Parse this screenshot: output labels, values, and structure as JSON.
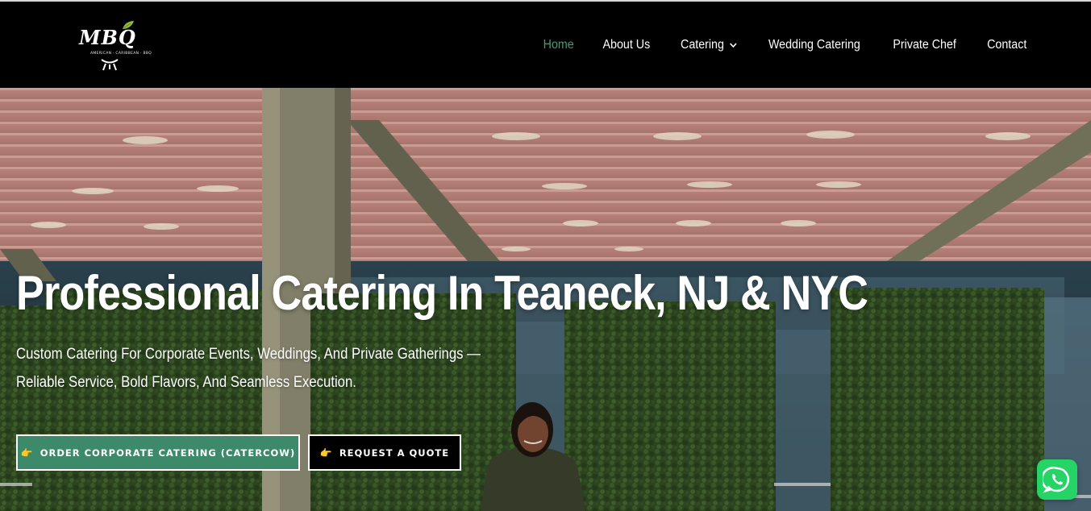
{
  "header": {
    "logo": {
      "mark": "MBQ",
      "subtitle": "AMERICAN · CARIBBEAN · BBQ",
      "icon": "grill-logo-icon"
    },
    "nav": [
      {
        "label": "Home",
        "active": true
      },
      {
        "label": "About Us",
        "active": false
      },
      {
        "label": "Catering",
        "active": false,
        "dropdown": true
      },
      {
        "label": "Wedding Catering",
        "active": false
      },
      {
        "label": "Private Chef",
        "active": false
      },
      {
        "label": "Contact",
        "active": false
      }
    ]
  },
  "hero": {
    "title": "Professional Catering In Teaneck, NJ & NYC",
    "subtitle_line1": "Custom Catering For Corporate Events, Weddings, And Private Gatherings —",
    "subtitle_line2": "Reliable Service, Bold Flavors, And Seamless Execution.",
    "buttons": {
      "primary": {
        "icon": "👉",
        "label": "ORDER CORPORATE CATERING (CATERCOW)"
      },
      "secondary": {
        "icon": "👉",
        "label": "REQUEST A QUOTE"
      }
    }
  },
  "widgets": {
    "whatsapp": {
      "icon": "whatsapp-icon"
    }
  },
  "colors": {
    "accent": "#3d8a6b",
    "nav_active": "#4a9a76",
    "header_bg": "#000000",
    "whatsapp": "#25d366"
  }
}
